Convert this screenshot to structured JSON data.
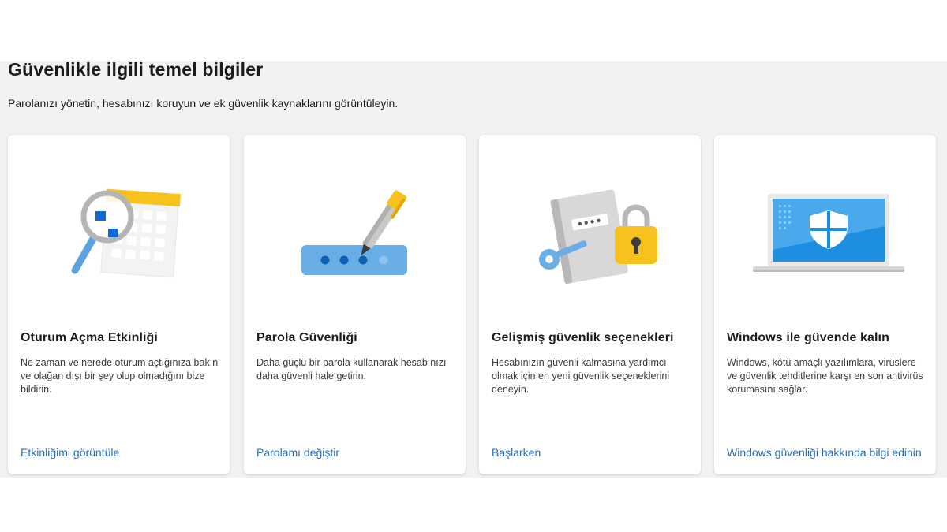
{
  "header": {
    "title": "Güvenlikle ilgili temel bilgiler",
    "subtitle": "Parolanızı yönetin, hesabınızı koruyun ve ek güvenlik kaynaklarını görüntüleyin."
  },
  "cards": [
    {
      "icon": "magnifier-calendar-icon",
      "title": "Oturum Açma Etkinliği",
      "description": "Ne zaman ve nerede oturum açtığınıza bakın ve olağan dışı bir şey olup olmadığını bize bildirin.",
      "link": "Etkinliğimi görüntüle"
    },
    {
      "icon": "password-pen-icon",
      "title": "Parola Güvenliği",
      "description": "Daha güçlü bir parola kullanarak hesabınızı daha güvenli hale getirin.",
      "link": "Parolamı değiştir"
    },
    {
      "icon": "key-lock-book-icon",
      "title": "Gelişmiş güvenlik seçenekleri",
      "description": "Hesabınızın güvenli kalmasına yardımcı olmak için en yeni güvenlik seçeneklerini deneyin.",
      "link": "Başlarken"
    },
    {
      "icon": "laptop-shield-icon",
      "title": "Windows ile güvende kalın",
      "description": "Windows, kötü amaçlı yazılımlara, virüslere ve güvenlik tehditlerine karşı en son antivirüs korumasını sağlar.",
      "link": "Windows güvenliği hakkında bilgi edinin"
    }
  ],
  "colors": {
    "link": "#2a6ebb",
    "panel_background": "#f2f2f2",
    "accent_yellow": "#f7c11e",
    "accent_blue": "#0078d4"
  }
}
